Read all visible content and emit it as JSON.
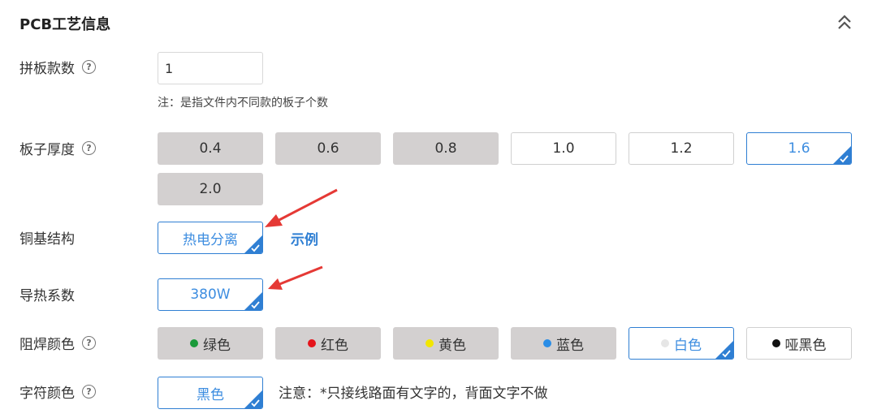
{
  "section": {
    "title": "PCB工艺信息"
  },
  "panel_count": {
    "label": "拼板款数",
    "value": "1",
    "note": "注：是指文件内不同款的板子个数"
  },
  "thickness": {
    "label": "板子厚度",
    "options": [
      "0.4",
      "0.6",
      "0.8",
      "1.0",
      "1.2",
      "1.6",
      "2.0"
    ],
    "states": [
      "disabled",
      "disabled",
      "disabled",
      "available",
      "available",
      "selected",
      "disabled"
    ]
  },
  "copper_structure": {
    "label": "铜基结构",
    "selected": "热电分离",
    "example_link": "示例"
  },
  "thermal": {
    "label": "导热系数",
    "selected": "380W"
  },
  "solder_mask": {
    "label": "阻焊颜色",
    "options": [
      {
        "label": "绿色",
        "dot": "#1a9a3a",
        "state": "disabled"
      },
      {
        "label": "红色",
        "dot": "#e5141b",
        "state": "disabled"
      },
      {
        "label": "黄色",
        "dot": "#f2e600",
        "state": "disabled"
      },
      {
        "label": "蓝色",
        "dot": "#2a8de6",
        "state": "disabled"
      },
      {
        "label": "白色",
        "dot": "#e6e6e6",
        "state": "selected"
      },
      {
        "label": "哑黑色",
        "dot": "#111111",
        "state": "available"
      }
    ]
  },
  "silkscreen": {
    "label": "字符颜色",
    "selected": "黑色",
    "notice": "注意：*只接线路面有文字的，背面文字不做"
  },
  "colors": {
    "accent": "#2f7fd3",
    "disabled_bg": "#d3d0d0",
    "annotation_arrow": "#e53935"
  }
}
